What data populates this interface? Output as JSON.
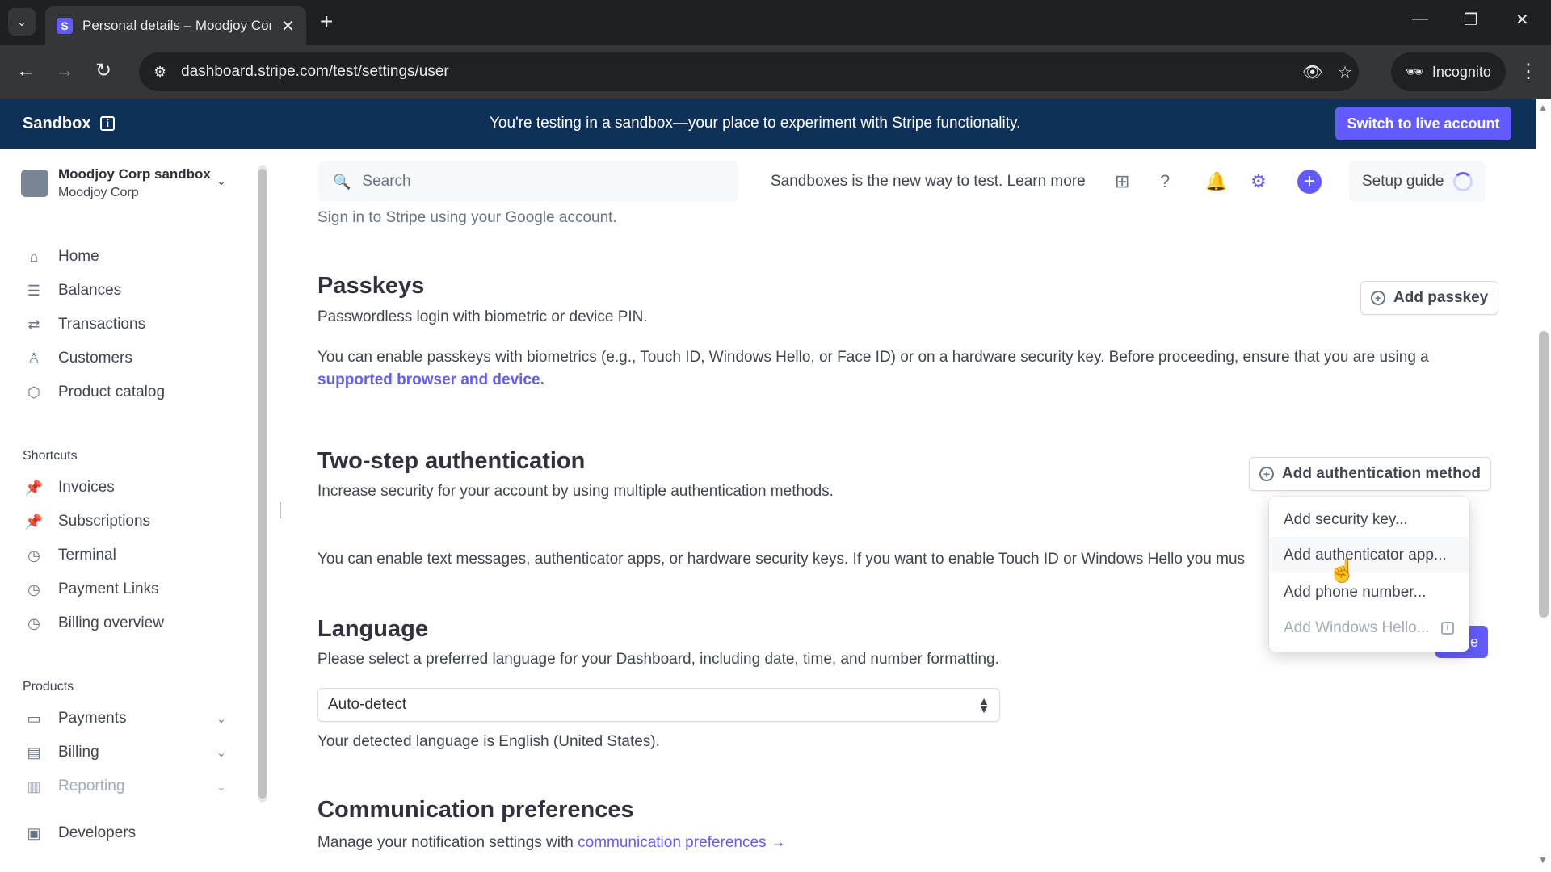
{
  "browser": {
    "tab_title": "Personal details – Moodjoy Cor",
    "favicon_letter": "S",
    "url": "dashboard.stripe.com/test/settings/user",
    "incognito_label": "Incognito"
  },
  "banner": {
    "title": "Sandbox",
    "message": "You're testing in a sandbox—your place to experiment with Stripe functionality.",
    "live_button": "Switch to live account"
  },
  "sidebar": {
    "account_name": "Moodjoy Corp sandbox",
    "account_sub": "Moodjoy Corp",
    "nav": [
      {
        "label": "Home",
        "icon": "home-icon"
      },
      {
        "label": "Balances",
        "icon": "balances-icon"
      },
      {
        "label": "Transactions",
        "icon": "transactions-icon"
      },
      {
        "label": "Customers",
        "icon": "customers-icon"
      },
      {
        "label": "Product catalog",
        "icon": "product-catalog-icon"
      }
    ],
    "shortcuts_label": "Shortcuts",
    "shortcuts": [
      {
        "label": "Invoices",
        "icon": "pin-icon"
      },
      {
        "label": "Subscriptions",
        "icon": "pin-icon"
      },
      {
        "label": "Terminal",
        "icon": "clock-icon"
      },
      {
        "label": "Payment Links",
        "icon": "clock-icon"
      },
      {
        "label": "Billing overview",
        "icon": "clock-icon"
      }
    ],
    "products_label": "Products",
    "products": [
      {
        "label": "Payments",
        "icon": "payments-icon"
      },
      {
        "label": "Billing",
        "icon": "billing-icon"
      },
      {
        "label": "Reporting",
        "icon": "reporting-icon"
      }
    ],
    "developers": "Developers"
  },
  "topbar": {
    "search_placeholder": "Search",
    "promo_text": "Sandboxes is the new way to test.",
    "promo_link": "Learn more",
    "setup_guide": "Setup guide"
  },
  "main": {
    "google_text": "Sign in to Stripe using your Google account.",
    "passkeys": {
      "title": "Passkeys",
      "subtitle": "Passwordless login with biometric or device PIN.",
      "button": "Add passkey",
      "body": "You can enable passkeys with biometrics (e.g., Touch ID, Windows Hello, or Face ID) or on a hardware security key. Before proceeding, ensure that you are using a",
      "link": "supported browser and device."
    },
    "two_step": {
      "title": "Two-step authentication",
      "subtitle": "Increase security for your account by using multiple authentication methods.",
      "button": "Add authentication method",
      "body": "You can enable text messages, authenticator apps, or hardware security keys. If you want to enable Touch ID or Windows Hello you mus"
    },
    "language": {
      "title": "Language",
      "subtitle": "Please select a preferred language for your Dashboard, including date, time, and number formatting.",
      "selected": "Auto-detect",
      "detected": "Your detected language is English (United States)."
    },
    "communication": {
      "title": "Communication preferences",
      "text": "Manage your notification settings with",
      "link": "communication preferences →"
    },
    "hidden_button_fragment": "e"
  },
  "menu": {
    "items": [
      {
        "label": "Add security key...",
        "disabled": false
      },
      {
        "label": "Add authenticator app...",
        "disabled": false
      },
      {
        "label": "Add phone number...",
        "disabled": false
      },
      {
        "label": "Add Windows Hello...",
        "disabled": true
      }
    ]
  },
  "colors": {
    "accent": "#635bff",
    "banner": "#0f3057"
  }
}
